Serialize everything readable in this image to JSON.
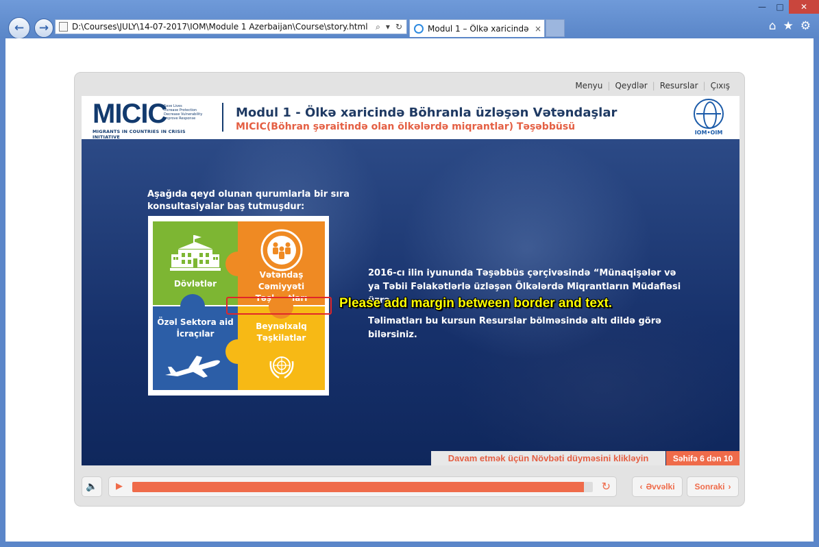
{
  "browser": {
    "address": "D:\\Courses\\JULY\\14-07-2017\\IOM\\Module 1 Azerbaijan\\Course\\story.html",
    "tab_title": "Modul 1 – Ölkə xaricində B...",
    "tab_close": "×",
    "window_buttons": {
      "minimize": "—",
      "maximize": "□",
      "close": "✕"
    },
    "address_tools": {
      "search": "⌕",
      "dropdown": "▾",
      "refresh": "↻"
    },
    "command_icons": {
      "home": "⌂",
      "favorites": "★",
      "settings": "⚙"
    }
  },
  "player_nav": {
    "items": [
      "Menyu",
      "Qeydlər",
      "Resurslar",
      "Çıxış"
    ]
  },
  "header": {
    "logo_word": "MICIC",
    "logo_taglines": [
      "Save Lives",
      "Increase Protection",
      "Decrease Vulnerability",
      "Improve Response"
    ],
    "logo_subtitle": "MIGRANTS IN COUNTRIES IN CRISIS INITIATIVE",
    "title": "Modul 1 - Ölkə xaricində Böhranla üzləşən Vətəndaşlar",
    "subtitle": "MICIC(Böhran şəraitində olan ölkələrdə miqrantlar) Təşəbbüsü",
    "iom_label": "IOM•OIM"
  },
  "slide": {
    "intro": "Aşağıda qeyd olunan qurumlarla bir sıra konsultasiyalar baş tutmuşdur:",
    "pieces": {
      "green": "Dövlətlər",
      "orange_1": "Vətəndaş",
      "orange_2": "Cəmiyyəti",
      "orange_3": "Təşkilatları",
      "blue_1": "Özəl Sektora aid",
      "blue_2": "İcraçılar",
      "yellow_1": "Beynəlxalq",
      "yellow_2": "Təşkilatlar"
    },
    "body_p1": "2016-cı ilin iyununda Təşəbbüs çərçivəsində “Münaqişələr və ya Təbii Fəlakətlərlə üzləşən Ölkələrdə Miqrantların Müdafiəsi üzrə",
    "body_p2": "Təlimatları bu kursun Resurslar bölməsində altı dildə görə bilərsiniz.",
    "annotation": "Please add margin between border and text.",
    "hint": "Davam etmək üçün Növbəti düyməsini klikləyin",
    "page_counter": "Səhifə 6 dən 10",
    "colors": {
      "green": "#7db633",
      "orange": "#ef8a23",
      "blue": "#2c5ea7",
      "yellow": "#f7b915",
      "accent": "#ef6b4a",
      "annotation": "#ffff00"
    }
  },
  "controls": {
    "progress": 0.98,
    "prev_label": "Əvvəlki",
    "next_label": "Sonraki",
    "prev_arrow": "‹",
    "next_arrow": "›",
    "play_glyph": "▶",
    "volume_glyph": "🔈",
    "replay_glyph": "↻"
  }
}
